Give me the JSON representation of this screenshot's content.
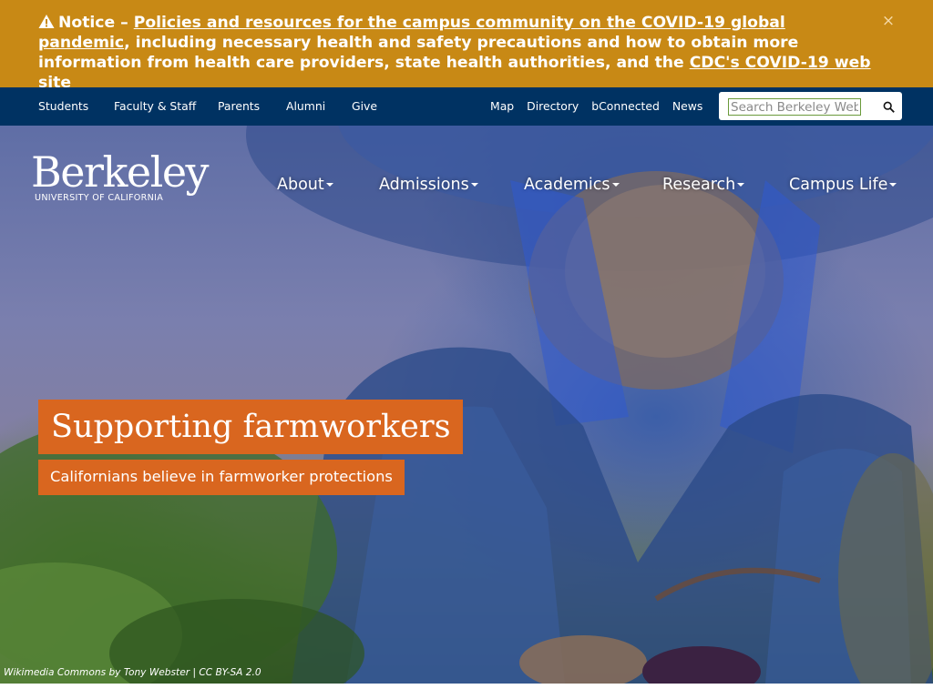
{
  "notice": {
    "lead": "Notice –",
    "link1": "Policies and resources for the campus community on the COVID-19 global pandemic",
    "middle": ", including necessary health and safety precautions and how to obtain more information from health care providers, state health authorities, and the",
    "link2": "CDC's COVID-19 web site",
    "close": "×",
    "color": "#c88915"
  },
  "audience_nav": {
    "items": [
      {
        "label": "Students"
      },
      {
        "label": "Faculty & Staff"
      },
      {
        "label": "Parents"
      },
      {
        "label": "Alumni"
      },
      {
        "label": "Give"
      }
    ]
  },
  "utility_nav": {
    "items": [
      {
        "label": "Map"
      },
      {
        "label": "Directory"
      },
      {
        "label": "bConnected"
      },
      {
        "label": "News"
      }
    ]
  },
  "search": {
    "placeholder": "Search Berkeley Web",
    "icon": "search-icon"
  },
  "logo": {
    "wordmark": "Berkeley",
    "subtitle": "UNIVERSITY OF CALIFORNIA"
  },
  "main_nav": {
    "items": [
      {
        "label": "About"
      },
      {
        "label": "Admissions"
      },
      {
        "label": "Academics"
      },
      {
        "label": "Research"
      },
      {
        "label": "Campus Life"
      }
    ]
  },
  "hero": {
    "title": "Supporting farmworkers",
    "subtitle": "Californians believe in farmworker protections",
    "credit": "Wikimedia Commons by Tony Webster | CC BY-SA 2.0",
    "accent_color": "#d9661f"
  },
  "colors": {
    "berkeley_blue": "#003262",
    "notice_gold": "#c88915",
    "california_gold": "#d9661f"
  }
}
